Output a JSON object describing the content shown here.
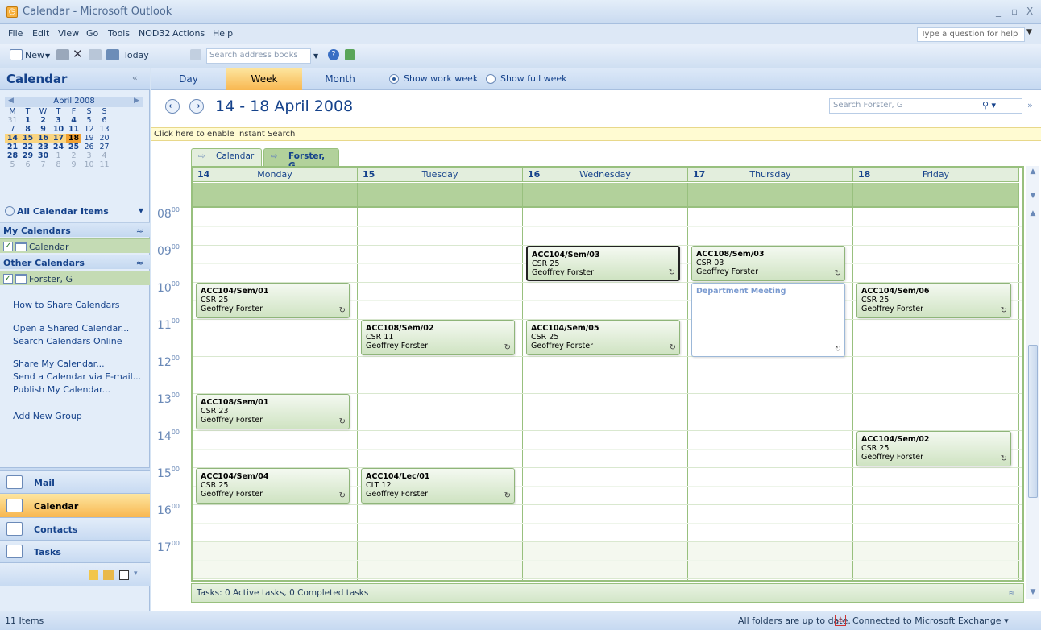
{
  "window": {
    "title": "Calendar - Microsoft Outlook",
    "min": "_",
    "max": "▫",
    "close": "X"
  },
  "menu": [
    "File",
    "Edit",
    "View",
    "Go",
    "Tools",
    "NOD32",
    "Actions",
    "Help"
  ],
  "help_placeholder": "Type a question for help",
  "toolbar": {
    "new_label": "New",
    "today_label": "Today",
    "search_placeholder": "Search address books"
  },
  "nav": {
    "title": "Calendar",
    "collapse": "«",
    "minical": {
      "month": "April 2008",
      "weekdays": [
        "M",
        "T",
        "W",
        "T",
        "F",
        "S",
        "S"
      ],
      "rows": [
        [
          "31",
          "1",
          "2",
          "3",
          "4",
          "5",
          "6"
        ],
        [
          "7",
          "8",
          "9",
          "10",
          "11",
          "12",
          "13"
        ],
        [
          "14",
          "15",
          "16",
          "17",
          "18",
          "19",
          "20"
        ],
        [
          "21",
          "22",
          "23",
          "24",
          "25",
          "26",
          "27"
        ],
        [
          "28",
          "29",
          "30",
          "1",
          "2",
          "3",
          "4"
        ],
        [
          "5",
          "6",
          "7",
          "8",
          "9",
          "10",
          "11"
        ]
      ],
      "selected_week_row": 2,
      "today": "18",
      "bold_dates": [
        "1",
        "2",
        "3",
        "4",
        "8",
        "9",
        "10",
        "11",
        "14",
        "15",
        "16",
        "17",
        "18",
        "21",
        "22",
        "23",
        "24",
        "25",
        "28",
        "29",
        "30"
      ]
    },
    "all_items": "All Calendar Items",
    "my_calendars": "My Calendars",
    "my_cal_item": "Calendar",
    "other_calendars": "Other Calendars",
    "other_cal_item": "Forster, G",
    "links": [
      "How to Share Calendars",
      "Open a Shared Calendar...",
      "Search Calendars Online",
      "Share My Calendar...",
      "Send a Calendar via E-mail...",
      "Publish My Calendar...",
      "Add New Group"
    ],
    "buttons": [
      "Mail",
      "Calendar",
      "Contacts",
      "Tasks"
    ]
  },
  "view_tabs": [
    "Day",
    "Week",
    "Month"
  ],
  "active_view": "Week",
  "options": [
    "Show work week",
    "Show full week"
  ],
  "selected_option": "Show work week",
  "date_range": "14 - 18 April 2008",
  "search_placeholder": "Search Forster, G",
  "instant_search": "Click here to enable Instant Search",
  "cal_tabs": [
    "Calendar",
    "Forster, G"
  ],
  "days": [
    {
      "num": "14",
      "name": "Monday"
    },
    {
      "num": "15",
      "name": "Tuesday"
    },
    {
      "num": "16",
      "name": "Wednesday"
    },
    {
      "num": "17",
      "name": "Thursday"
    },
    {
      "num": "18",
      "name": "Friday"
    }
  ],
  "hours": [
    "08",
    "09",
    "10",
    "11",
    "12",
    "13",
    "14",
    "15",
    "16",
    "17"
  ],
  "minutes": "00",
  "appointments": [
    {
      "day": 0,
      "start": "10:00",
      "subject": "ACC104/Sem/01",
      "location": "CSR 25",
      "organizer": "Geoffrey Forster",
      "recurring": true
    },
    {
      "day": 0,
      "start": "13:00",
      "subject": "ACC108/Sem/01",
      "location": "CSR 23",
      "organizer": "Geoffrey Forster",
      "recurring": true
    },
    {
      "day": 0,
      "start": "15:00",
      "subject": "ACC104/Sem/04",
      "location": "CSR 25",
      "organizer": "Geoffrey Forster",
      "recurring": true
    },
    {
      "day": 1,
      "start": "11:00",
      "subject": "ACC108/Sem/02",
      "location": "CSR 11",
      "organizer": "Geoffrey Forster",
      "recurring": true
    },
    {
      "day": 1,
      "start": "15:00",
      "subject": "ACC104/Lec/01",
      "location": "CLT 12",
      "organizer": "Geoffrey Forster",
      "recurring": true
    },
    {
      "day": 2,
      "start": "09:00",
      "subject": "ACC104/Sem/03",
      "location": "CSR 25",
      "organizer": "Geoffrey Forster",
      "recurring": true,
      "selected": true
    },
    {
      "day": 2,
      "start": "11:00",
      "subject": "ACC104/Sem/05",
      "location": "CSR 25",
      "organizer": "Geoffrey Forster",
      "recurring": true
    },
    {
      "day": 3,
      "start": "09:00",
      "subject": "ACC108/Sem/03",
      "location": "CSR 03",
      "organizer": "Geoffrey Forster",
      "recurring": true
    },
    {
      "day": 3,
      "start": "10:00",
      "end": "12:00",
      "subject": "Department Meeting",
      "recurring": true,
      "tentative": true
    },
    {
      "day": 4,
      "start": "10:00",
      "subject": "ACC104/Sem/06",
      "location": "CSR 25",
      "organizer": "Geoffrey Forster",
      "recurring": true
    },
    {
      "day": 4,
      "start": "14:00",
      "subject": "ACC104/Sem/02",
      "location": "CSR 25",
      "organizer": "Geoffrey Forster",
      "recurring": true
    }
  ],
  "tasks_bar": "Tasks: 0 Active tasks, 0 Completed tasks",
  "status": {
    "items": "11 Items",
    "sync": "All folders are up to date.",
    "exchange": "Connected to Microsoft Exchange ▾"
  },
  "colors": {
    "accent": "#f8b750",
    "calendar_green": "#98c07e",
    "nav_blue": "#15428b"
  }
}
